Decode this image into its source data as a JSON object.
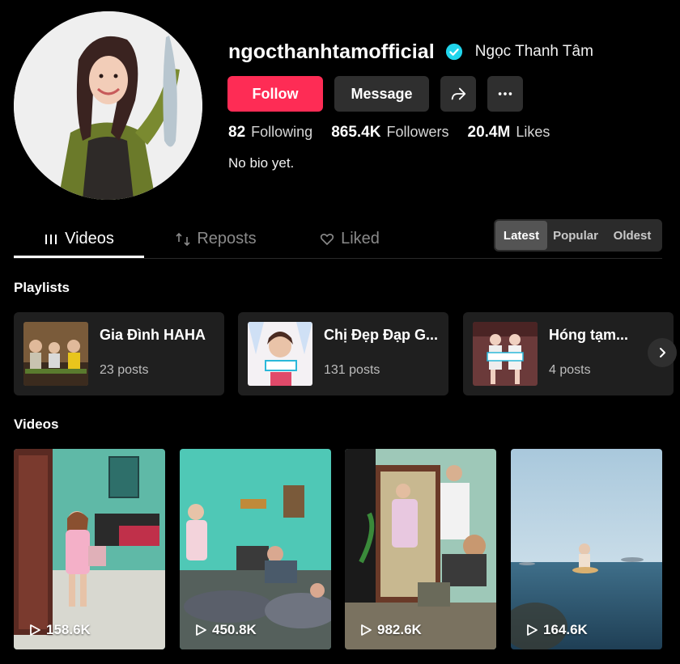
{
  "profile": {
    "username": "ngocthanhtamofficial",
    "nickname": "Ngọc Thanh Tâm",
    "bio": "No bio yet.",
    "stats": [
      {
        "num": "82",
        "label": "Following"
      },
      {
        "num": "865.4K",
        "label": "Followers"
      },
      {
        "num": "20.4M",
        "label": "Likes"
      }
    ]
  },
  "actions": {
    "follow": "Follow",
    "message": "Message"
  },
  "tabs": [
    {
      "label": "Videos",
      "icon": "grid-icon",
      "active": true
    },
    {
      "label": "Reposts",
      "icon": "repost-icon",
      "active": false
    },
    {
      "label": "Liked",
      "icon": "heart-icon",
      "active": false
    }
  ],
  "sort": [
    {
      "label": "Latest",
      "active": true
    },
    {
      "label": "Popular",
      "active": false
    },
    {
      "label": "Oldest",
      "active": false
    }
  ],
  "sections": {
    "playlists": "Playlists",
    "videos": "Videos"
  },
  "playlists": [
    {
      "name": "Gia Đình HAHA",
      "count": "23 posts"
    },
    {
      "name": "Chị Đẹp Đạp G...",
      "count": "131 posts"
    },
    {
      "name": "Hóng tạm...",
      "count": "4 posts"
    }
  ],
  "videos": [
    {
      "views": "158.6K"
    },
    {
      "views": "450.8K"
    },
    {
      "views": "982.6K"
    },
    {
      "views": "164.6K"
    }
  ],
  "colors": {
    "accent": "#fe2c55",
    "verified": "#20d5ec",
    "card": "#1f1f1f",
    "button": "#2f2f2f"
  }
}
